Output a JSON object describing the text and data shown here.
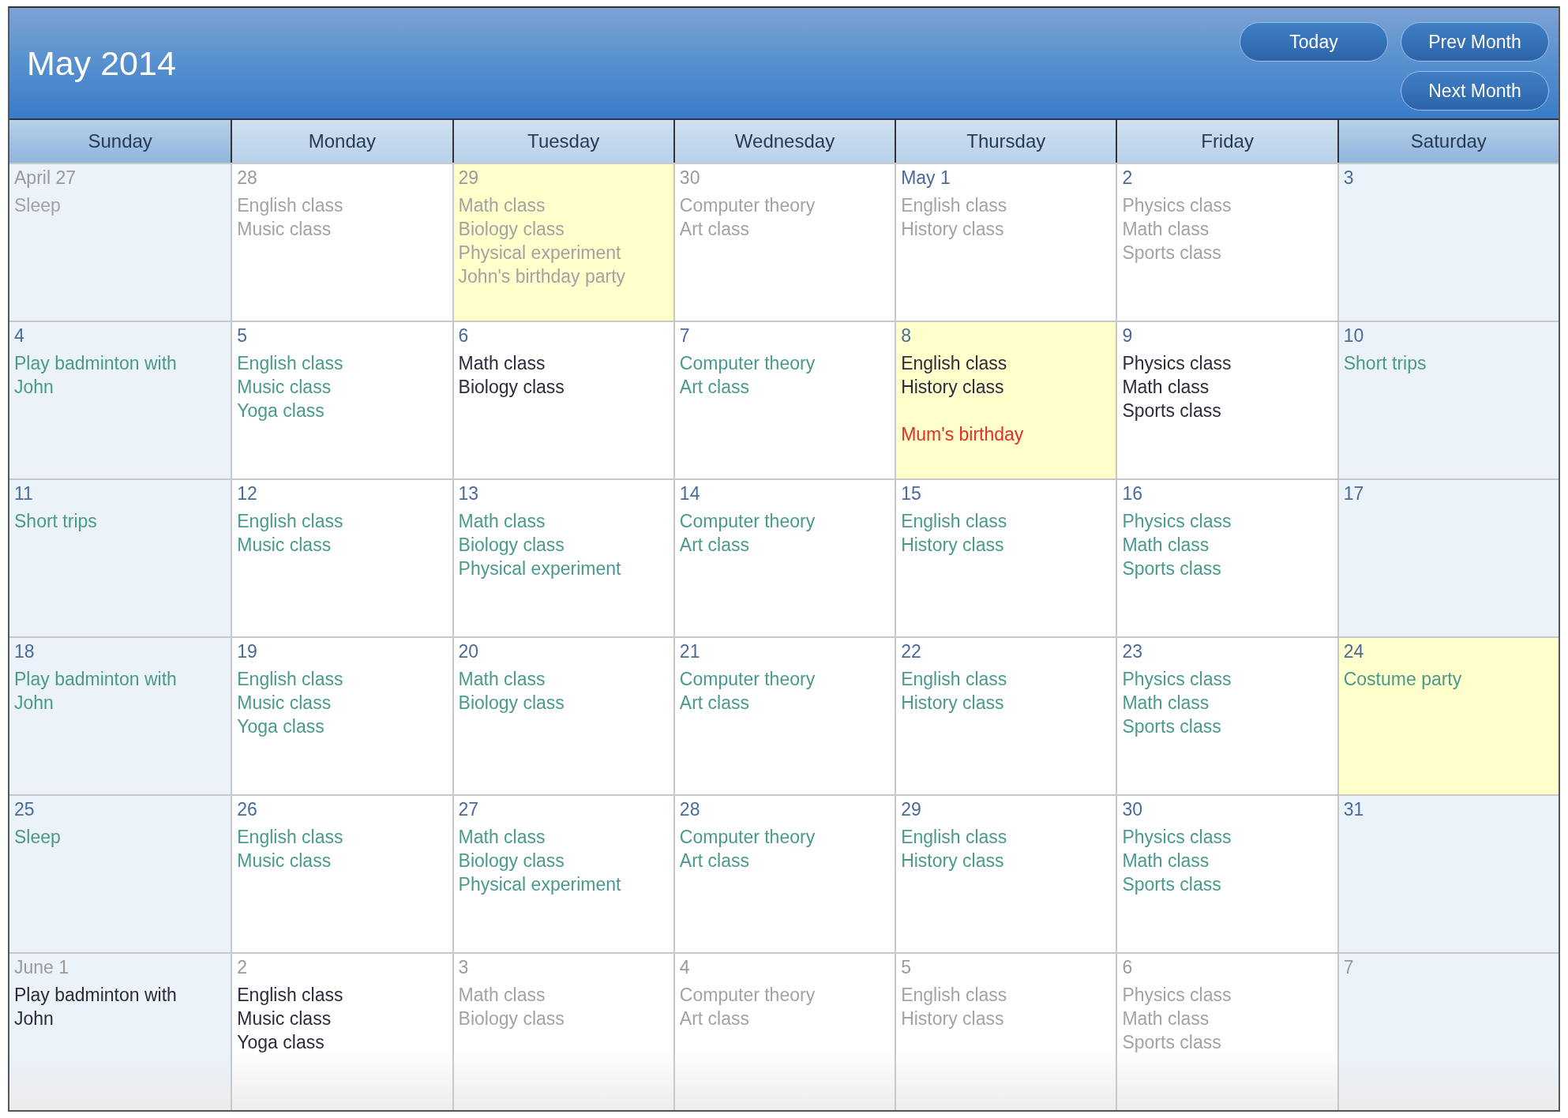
{
  "title": "May 2014",
  "buttons": [
    "Today",
    "Prev Month",
    "Next Month"
  ],
  "weekdays": [
    "Sunday",
    "Monday",
    "Tuesday",
    "Wednesday",
    "Thursday",
    "Friday",
    "Saturday"
  ],
  "weeks": [
    [
      {
        "label": "April 27",
        "in_month": false,
        "highlighted": false,
        "events": [
          {
            "text": "Sleep",
            "color": "#a3a3a3"
          }
        ]
      },
      {
        "label": "28",
        "in_month": false,
        "highlighted": false,
        "events": [
          {
            "text": "English class",
            "color": "#a3a3a3"
          },
          {
            "text": "Music class",
            "color": "#a3a3a3"
          }
        ]
      },
      {
        "label": "29",
        "in_month": false,
        "highlighted": true,
        "events": [
          {
            "text": "Math class",
            "color": "#a3a3a3"
          },
          {
            "text": "Biology class",
            "color": "#a3a3a3"
          },
          {
            "text": "Physical experiment",
            "color": "#a3a3a3"
          },
          {
            "text": "John's birthday party",
            "color": "#a3a3a3"
          }
        ]
      },
      {
        "label": "30",
        "in_month": false,
        "highlighted": false,
        "events": [
          {
            "text": "Computer theory",
            "color": "#a3a3a3"
          },
          {
            "text": "Art class",
            "color": "#a3a3a3"
          }
        ]
      },
      {
        "label": "May 1",
        "in_month": true,
        "highlighted": false,
        "events": [
          {
            "text": "English class",
            "color": "#a3a3a3"
          },
          {
            "text": "History class",
            "color": "#a3a3a3"
          }
        ]
      },
      {
        "label": "2",
        "in_month": true,
        "highlighted": false,
        "events": [
          {
            "text": "Physics class",
            "color": "#a3a3a3"
          },
          {
            "text": "Math class",
            "color": "#a3a3a3"
          },
          {
            "text": "Sports class",
            "color": "#a3a3a3"
          }
        ]
      },
      {
        "label": "3",
        "in_month": true,
        "highlighted": false
      }
    ],
    [
      {
        "label": "4",
        "in_month": true,
        "highlighted": false,
        "events": [
          {
            "text": "Play badminton with John",
            "color": "#4a9a8c"
          }
        ]
      },
      {
        "label": "5",
        "in_month": true,
        "highlighted": false,
        "events": [
          {
            "text": "English class",
            "color": "#4a9a8c"
          },
          {
            "text": "Music class",
            "color": "#4a9a8c"
          },
          {
            "text": "Yoga class",
            "color": "#4a9a8c"
          }
        ]
      },
      {
        "label": "6",
        "in_month": true,
        "highlighted": false,
        "events": [
          {
            "text": "Math class",
            "color": "#2b2b3b"
          },
          {
            "text": "Biology class",
            "color": "#2b2b3b"
          }
        ]
      },
      {
        "label": "7",
        "in_month": true,
        "highlighted": false,
        "events": [
          {
            "text": "Computer theory",
            "color": "#4a9a8c"
          },
          {
            "text": "Art class",
            "color": "#4a9a8c"
          }
        ]
      },
      {
        "label": "8",
        "in_month": true,
        "highlighted": true,
        "events": [
          {
            "text": "English class",
            "color": "#2b2b3b"
          },
          {
            "text": "History class",
            "color": "#2b2b3b"
          },
          {
            "text": "Mum's birthday",
            "color": "#e0302a",
            "gap_before": true
          }
        ]
      },
      {
        "label": "9",
        "in_month": true,
        "highlighted": false,
        "events": [
          {
            "text": "Physics class",
            "color": "#2b2b3b"
          },
          {
            "text": "Math class",
            "color": "#2b2b3b"
          },
          {
            "text": "Sports class",
            "color": "#2b2b3b"
          }
        ]
      },
      {
        "label": "10",
        "in_month": true,
        "highlighted": false,
        "events": [
          {
            "text": "Short trips",
            "color": "#4a9a8c"
          }
        ]
      }
    ],
    [
      {
        "label": "11",
        "in_month": true,
        "highlighted": false,
        "events": [
          {
            "text": "Short trips",
            "color": "#4a9a8c"
          }
        ]
      },
      {
        "label": "12",
        "in_month": true,
        "highlighted": false,
        "events": [
          {
            "text": "English class",
            "color": "#4a9a8c"
          },
          {
            "text": "Music class",
            "color": "#4a9a8c"
          }
        ]
      },
      {
        "label": "13",
        "in_month": true,
        "highlighted": false,
        "events": [
          {
            "text": "Math class",
            "color": "#4a9a8c"
          },
          {
            "text": "Biology class",
            "color": "#4a9a8c"
          },
          {
            "text": "Physical experiment",
            "color": "#4a9a8c"
          }
        ]
      },
      {
        "label": "14",
        "in_month": true,
        "highlighted": false,
        "events": [
          {
            "text": "Computer theory",
            "color": "#4a9a8c"
          },
          {
            "text": "Art class",
            "color": "#4a9a8c"
          }
        ]
      },
      {
        "label": "15",
        "in_month": true,
        "highlighted": false,
        "events": [
          {
            "text": "English class",
            "color": "#4a9a8c"
          },
          {
            "text": "History class",
            "color": "#4a9a8c"
          }
        ]
      },
      {
        "label": "16",
        "in_month": true,
        "highlighted": false,
        "events": [
          {
            "text": "Physics class",
            "color": "#4a9a8c"
          },
          {
            "text": "Math class",
            "color": "#4a9a8c"
          },
          {
            "text": "Sports class",
            "color": "#4a9a8c"
          }
        ]
      },
      {
        "label": "17",
        "in_month": true,
        "highlighted": false
      }
    ],
    [
      {
        "label": "18",
        "in_month": true,
        "highlighted": false,
        "events": [
          {
            "text": "Play badminton with John",
            "color": "#4a9a8c"
          }
        ]
      },
      {
        "label": "19",
        "in_month": true,
        "highlighted": false,
        "events": [
          {
            "text": "English class",
            "color": "#4a9a8c"
          },
          {
            "text": "Music class",
            "color": "#4a9a8c"
          },
          {
            "text": "Yoga class",
            "color": "#4a9a8c"
          }
        ]
      },
      {
        "label": "20",
        "in_month": true,
        "highlighted": false,
        "events": [
          {
            "text": "Math class",
            "color": "#4a9a8c"
          },
          {
            "text": "Biology class",
            "color": "#4a9a8c"
          }
        ]
      },
      {
        "label": "21",
        "in_month": true,
        "highlighted": false,
        "events": [
          {
            "text": "Computer theory",
            "color": "#4a9a8c"
          },
          {
            "text": "Art class",
            "color": "#4a9a8c"
          }
        ]
      },
      {
        "label": "22",
        "in_month": true,
        "highlighted": false,
        "events": [
          {
            "text": "English class",
            "color": "#4a9a8c"
          },
          {
            "text": "History class",
            "color": "#4a9a8c"
          }
        ]
      },
      {
        "label": "23",
        "in_month": true,
        "highlighted": false,
        "events": [
          {
            "text": "Physics class",
            "color": "#4a9a8c"
          },
          {
            "text": "Math class",
            "color": "#4a9a8c"
          },
          {
            "text": "Sports class",
            "color": "#4a9a8c"
          }
        ]
      },
      {
        "label": "24",
        "in_month": true,
        "highlighted": true,
        "events": [
          {
            "text": "Costume party",
            "color": "#4a9a8c"
          }
        ]
      }
    ],
    [
      {
        "label": "25",
        "in_month": true,
        "highlighted": false,
        "events": [
          {
            "text": "Sleep",
            "color": "#4a9a8c"
          }
        ]
      },
      {
        "label": "26",
        "in_month": true,
        "highlighted": false,
        "events": [
          {
            "text": "English class",
            "color": "#4a9a8c"
          },
          {
            "text": "Music class",
            "color": "#4a9a8c"
          }
        ]
      },
      {
        "label": "27",
        "in_month": true,
        "highlighted": false,
        "events": [
          {
            "text": "Math class",
            "color": "#4a9a8c"
          },
          {
            "text": "Biology class",
            "color": "#4a9a8c"
          },
          {
            "text": "Physical experiment",
            "color": "#4a9a8c"
          }
        ]
      },
      {
        "label": "28",
        "in_month": true,
        "highlighted": false,
        "events": [
          {
            "text": "Computer theory",
            "color": "#4a9a8c"
          },
          {
            "text": "Art class",
            "color": "#4a9a8c"
          }
        ]
      },
      {
        "label": "29",
        "in_month": true,
        "highlighted": false,
        "events": [
          {
            "text": "English class",
            "color": "#4a9a8c"
          },
          {
            "text": "History class",
            "color": "#4a9a8c"
          }
        ]
      },
      {
        "label": "30",
        "in_month": true,
        "highlighted": false,
        "events": [
          {
            "text": "Physics class",
            "color": "#4a9a8c"
          },
          {
            "text": "Math class",
            "color": "#4a9a8c"
          },
          {
            "text": "Sports class",
            "color": "#4a9a8c"
          }
        ]
      },
      {
        "label": "31",
        "in_month": true,
        "highlighted": false
      }
    ],
    [
      {
        "label": "June 1",
        "in_month": false,
        "highlighted": false,
        "events": [
          {
            "text": "Play badminton with John",
            "color": "#2b2b3b"
          }
        ]
      },
      {
        "label": "2",
        "in_month": false,
        "highlighted": false,
        "events": [
          {
            "text": "English class",
            "color": "#2b2b3b"
          },
          {
            "text": "Music class",
            "color": "#2b2b3b"
          },
          {
            "text": "Yoga class",
            "color": "#2b2b3b"
          }
        ]
      },
      {
        "label": "3",
        "in_month": false,
        "highlighted": false,
        "events": [
          {
            "text": "Math class",
            "color": "#a3a3a3"
          },
          {
            "text": "Biology class",
            "color": "#a3a3a3"
          }
        ]
      },
      {
        "label": "4",
        "in_month": false,
        "highlighted": false,
        "events": [
          {
            "text": "Computer theory",
            "color": "#a3a3a3"
          },
          {
            "text": "Art class",
            "color": "#a3a3a3"
          }
        ]
      },
      {
        "label": "5",
        "in_month": false,
        "highlighted": false,
        "events": [
          {
            "text": "English class",
            "color": "#a3a3a3"
          },
          {
            "text": "History class",
            "color": "#a3a3a3"
          }
        ]
      },
      {
        "label": "6",
        "in_month": false,
        "highlighted": false,
        "events": [
          {
            "text": "Physics class",
            "color": "#a3a3a3"
          },
          {
            "text": "Math class",
            "color": "#a3a3a3"
          },
          {
            "text": "Sports class",
            "color": "#a3a3a3"
          }
        ]
      },
      {
        "label": "7",
        "in_month": false,
        "highlighted": false
      }
    ]
  ]
}
